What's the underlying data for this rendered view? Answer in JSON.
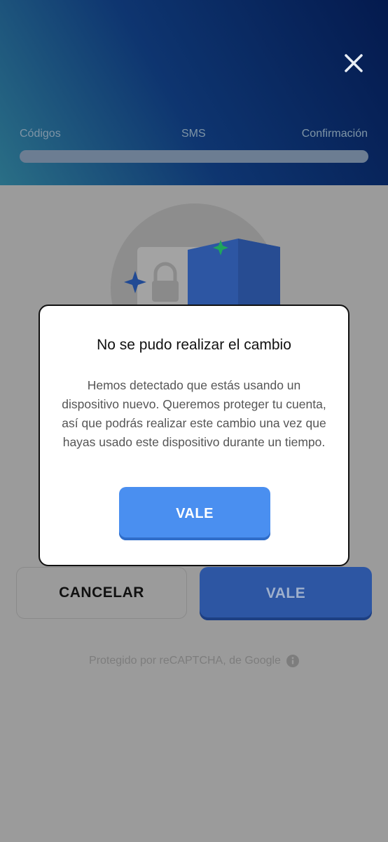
{
  "header": {
    "steps": [
      "Códigos",
      "SMS",
      "Confirmación"
    ],
    "progress": 0
  },
  "background_actions": {
    "cancel_label": "CANCELAR",
    "ok_label": "VALE"
  },
  "footer": {
    "recaptcha_text": "Protegido por reCAPTCHA, de Google"
  },
  "dialog": {
    "title": "No se pudo realizar el cambio",
    "message": "Hemos detectado que estás usando un dispositivo nuevo. Queremos proteger tu cuenta, así que podrás realizar este cambio una vez que hayas usado este dispositivo durante un tiempo.",
    "ok_label": "VALE"
  },
  "icons": {
    "close": "close-icon",
    "info": "info-icon",
    "lock": "lock-icon",
    "shield": "shield-icon",
    "sparkle": "sparkle-icon"
  },
  "colors": {
    "primary_button": "#4a8ff0",
    "header_dark": "#041a4e",
    "accent_green": "#1fa55c"
  }
}
